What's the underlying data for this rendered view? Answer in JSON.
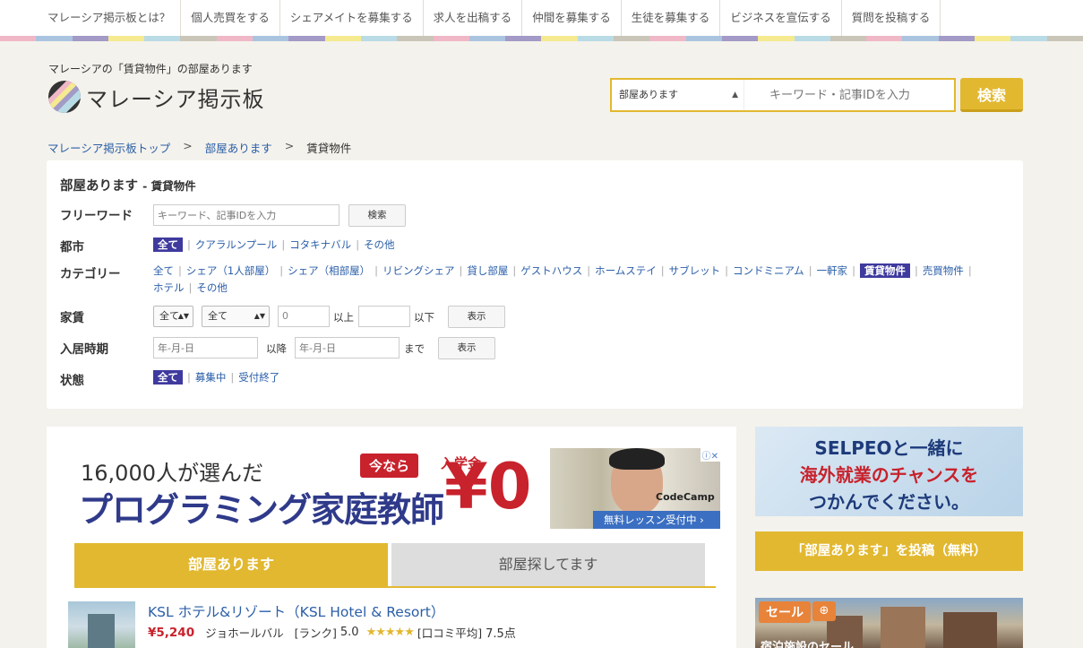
{
  "nav": [
    "マレーシア掲示板とは？",
    "個人売買をする",
    "シェアメイトを募集する",
    "求人を出稿する",
    "仲間を募集する",
    "生徒を募集する",
    "ビジネスを宣伝する",
    "質問を投稿する"
  ],
  "stripe_colors": [
    "#f0b8c7",
    "#aac4e0",
    "#a39ac7",
    "#f5ea8f",
    "#b9dbe6",
    "#c9c5b8"
  ],
  "header": {
    "tagline": "マレーシアの「賃貸物件」の部屋あります",
    "logo_text": "マレーシア掲示板"
  },
  "search": {
    "category": "部屋あります",
    "placeholder": "キーワード・記事IDを入力",
    "button": "検索"
  },
  "breadcrumb": [
    "マレーシア掲示板トップ",
    "部屋あります",
    "賃貸物件"
  ],
  "filter": {
    "title": "部屋あります",
    "subtitle": "- 賃貸物件",
    "freeword": {
      "label": "フリーワード",
      "placeholder": "キーワード、記事IDを入力",
      "button": "検索"
    },
    "city": {
      "label": "都市",
      "options": [
        "全て",
        "クアラルンプール",
        "コタキナバル",
        "その他"
      ],
      "selected": "全て"
    },
    "category": {
      "label": "カテゴリー",
      "row1": [
        "全て",
        "シェア（1人部屋）",
        "シェア（相部屋）",
        "リビングシェア",
        "貸し部屋",
        "ゲストハウス",
        "ホームステイ",
        "サブレット",
        "コンドミニアム",
        "一軒家",
        "賃貸物件",
        "売買物件"
      ],
      "row2": [
        "ホテル",
        "その他"
      ],
      "selected": "賃貸物件"
    },
    "rent": {
      "label": "家賃",
      "currency": "全て",
      "period": "全て",
      "min": "0",
      "max": "",
      "above": "以上",
      "below": "以下",
      "button": "表示"
    },
    "movein": {
      "label": "入居時期",
      "from_placeholder": "年-月-日",
      "after": "以降",
      "to_placeholder": "年-月-日",
      "until": "まで",
      "button": "表示"
    },
    "status": {
      "label": "状態",
      "options": [
        "全て",
        "募集中",
        "受付終了"
      ],
      "selected": "全て"
    }
  },
  "banner": {
    "line1": "16,000人が選んだ",
    "line2": "プログラミング家庭教師",
    "now": "今なら",
    "fee": "入学金",
    "zero": "¥0",
    "brand": "CodeCamp",
    "lesson": "無料レッスン受付中",
    "adchoices": "ⓘ✕"
  },
  "tabs": {
    "active": "部屋あります",
    "inactive": "部屋探してます"
  },
  "listing": {
    "title": "KSL ホテル&リゾート（KSL Hotel & Resort）",
    "price": "¥5,240",
    "location": "ジョホールバル",
    "rank_label": "[ランク]",
    "rank": "5.0",
    "stars": "★★★★★",
    "review_label": "[口コミ平均]",
    "review": "7.5点",
    "rating_fraction": 1.0
  },
  "sidebar": {
    "ad": {
      "l1": "SELPEOと一緒に",
      "l2": "海外就業のチャンスを",
      "l3": "つかんでください。"
    },
    "post_button": "「部屋あります」を投稿（無料）",
    "sale": "セール",
    "sale_caption": "宿泊施設のセール"
  },
  "colors": {
    "accent": "#e2b830",
    "selected": "#3f3a9e",
    "link": "#2a5ea8",
    "price": "#c8222c"
  }
}
